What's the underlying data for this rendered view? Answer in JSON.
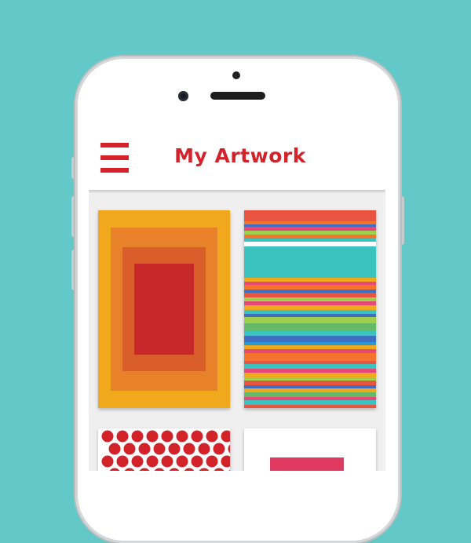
{
  "app": {
    "title": "My Artwork",
    "menu_icon": "hamburger-menu-icon"
  },
  "colors": {
    "background": "#63c8c8",
    "accent": "#d2232a",
    "phone_body": "#ffffff"
  },
  "artworks": [
    {
      "name": "nested-rectangles",
      "colors": [
        "#f0a91d",
        "#e7812a",
        "#da5e2a",
        "#c8282a"
      ]
    },
    {
      "name": "horizontal-stripes",
      "colors": [
        "#e85440",
        "#3bc3c0",
        "#f0a91d",
        "#9ecf4d",
        "#3e6fc1",
        "#f5742c",
        "#66b966",
        "#e8477a"
      ]
    },
    {
      "name": "polka-dots",
      "colors": [
        "#d2232a",
        "#ffffff"
      ]
    },
    {
      "name": "pink-shape",
      "colors": [
        "#e03a62"
      ]
    }
  ]
}
